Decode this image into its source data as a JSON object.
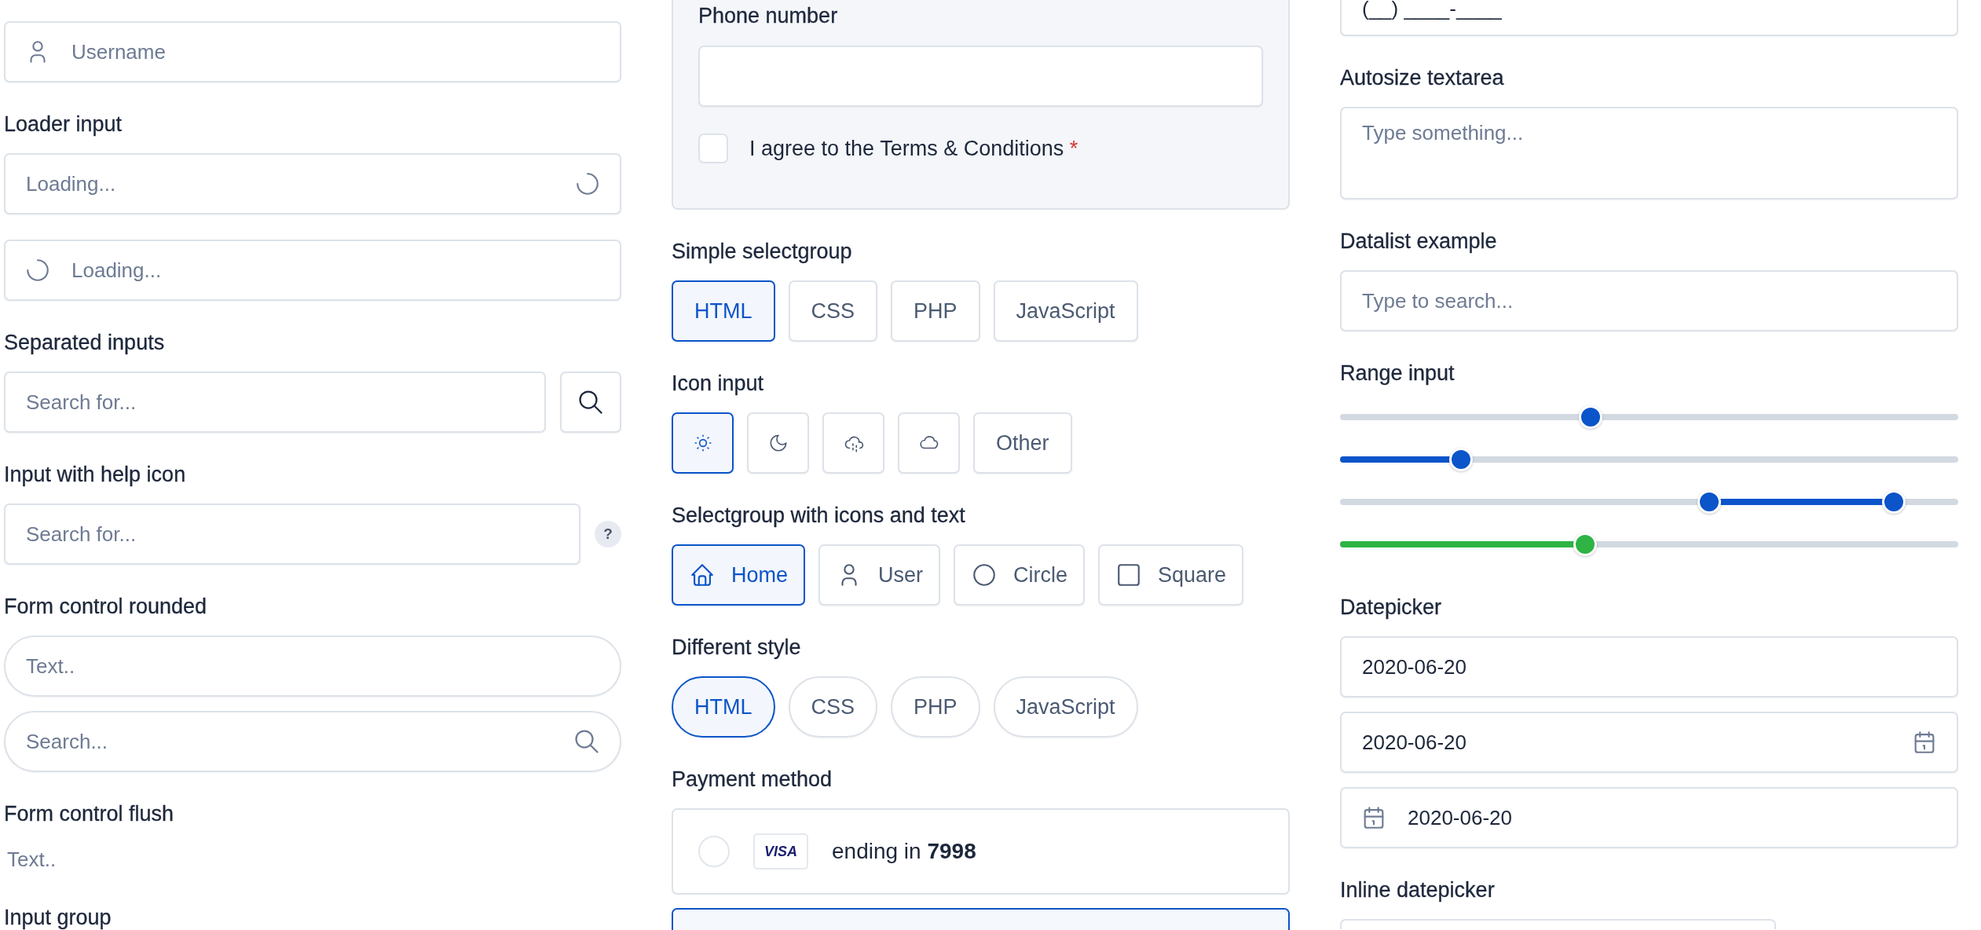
{
  "columns": [
    {
      "sections": [
        {
          "controls": [
            {
              "kind": "user",
              "placeholder": "Username"
            }
          ]
        },
        {
          "label": "Loader input",
          "controls": [
            {
              "kind": "loader",
              "placeholder": "Loading..."
            },
            {
              "kind": "preloader",
              "placeholder": "Loading..."
            }
          ]
        },
        {
          "label": "Separated inputs",
          "controls": [
            {
              "kind": "searchsplit",
              "placeholder": "Search for..."
            }
          ]
        },
        {
          "label": "Input with help icon",
          "controls": [
            {
              "kind": "help",
              "placeholder": "Search for...",
              "help": "?"
            }
          ]
        },
        {
          "label": "Form control rounded",
          "controls": [
            {
              "kind": "rounded",
              "placeholder": "Text.."
            },
            {
              "kind": "roundsearch",
              "placeholder": "Search..."
            }
          ]
        },
        {
          "label": "Form control flush",
          "controls": [
            {
              "kind": "flush",
              "placeholder": "Text.."
            }
          ]
        },
        {
          "label": "Input group"
        }
      ]
    },
    {
      "sections": [
        {
          "controls": [
            {
              "kind": "phonecard",
              "label": "Phone number",
              "consent": "I agree to the Terms & Conditions",
              "required_mark": "*",
              "checked": false
            }
          ]
        },
        {
          "label": "Simple selectgroup",
          "controls": [
            {
              "kind": "selectgroup",
              "options": [
                {
                  "label": "HTML",
                  "selected": true
                },
                {
                  "label": "CSS",
                  "selected": false
                },
                {
                  "label": "PHP",
                  "selected": false
                },
                {
                  "label": "JavaScript",
                  "selected": false
                }
              ]
            }
          ]
        },
        {
          "label": "Icon input",
          "controls": [
            {
              "kind": "iconselect",
              "options": [
                {
                  "kind": "sun",
                  "selected": true
                },
                {
                  "kind": "moon",
                  "selected": false
                },
                {
                  "kind": "storm",
                  "selected": false
                },
                {
                  "kind": "cloud",
                  "selected": false
                },
                {
                  "kind": "text",
                  "label": "Other",
                  "selected": false
                }
              ]
            }
          ]
        },
        {
          "label": "Selectgroup with icons and text",
          "controls": [
            {
              "kind": "icontextselect",
              "options": [
                {
                  "kind": "home",
                  "label": "Home",
                  "selected": true
                },
                {
                  "kind": "person",
                  "label": "User",
                  "selected": false
                },
                {
                  "kind": "circle",
                  "label": "Circle",
                  "selected": false
                },
                {
                  "kind": "square",
                  "label": "Square",
                  "selected": false
                }
              ]
            }
          ]
        },
        {
          "label": "Different style",
          "controls": [
            {
              "kind": "pillgroup",
              "options": [
                {
                  "label": "HTML",
                  "selected": true
                },
                {
                  "label": "CSS",
                  "selected": false
                },
                {
                  "label": "PHP",
                  "selected": false
                },
                {
                  "label": "JavaScript",
                  "selected": false
                }
              ]
            }
          ]
        },
        {
          "label": "Payment method",
          "controls": [
            {
              "kind": "payment",
              "cards": [
                {
                  "brand": "VISA",
                  "text": "ending in **7998**",
                  "selected": false
                },
                {
                  "selected": true
                }
              ]
            }
          ]
        }
      ]
    },
    {
      "sections": [
        {
          "controls": [
            {
              "kind": "masked",
              "value": "(__) ____-____"
            }
          ]
        },
        {
          "label": "Autosize textarea",
          "controls": [
            {
              "kind": "textarea",
              "placeholder": "Type something..."
            }
          ]
        },
        {
          "label": "Datalist example",
          "controls": [
            {
              "kind": "datalist",
              "placeholder": "Type to search..."
            }
          ]
        },
        {
          "label": "Range input",
          "controls": [
            {
              "kind": "slider",
              "level": 0.405,
              "color": "#0b54c9"
            },
            {
              "kind": "fillslider",
              "level": 0.196,
              "color": "#0b54c9"
            },
            {
              "kind": "dualslider",
              "color": "#0b54c9",
              "thumbs": [
                {
                  "level": 0.597
                },
                {
                  "level": 0.896
                }
              ]
            },
            {
              "kind": "fillslider",
              "level": 0.397,
              "color": "#2fb344"
            }
          ]
        },
        {
          "label": "Datepicker",
          "controls": [
            {
              "kind": "date",
              "value": "2020-06-20"
            },
            {
              "kind": "calendar",
              "value": "2020-06-20"
            },
            {
              "kind": "leadcalendar",
              "value": "2020-06-20"
            }
          ]
        },
        {
          "label": "Inline datepicker",
          "controls": [
            {
              "kind": "inlinecal"
            }
          ]
        }
      ]
    }
  ]
}
